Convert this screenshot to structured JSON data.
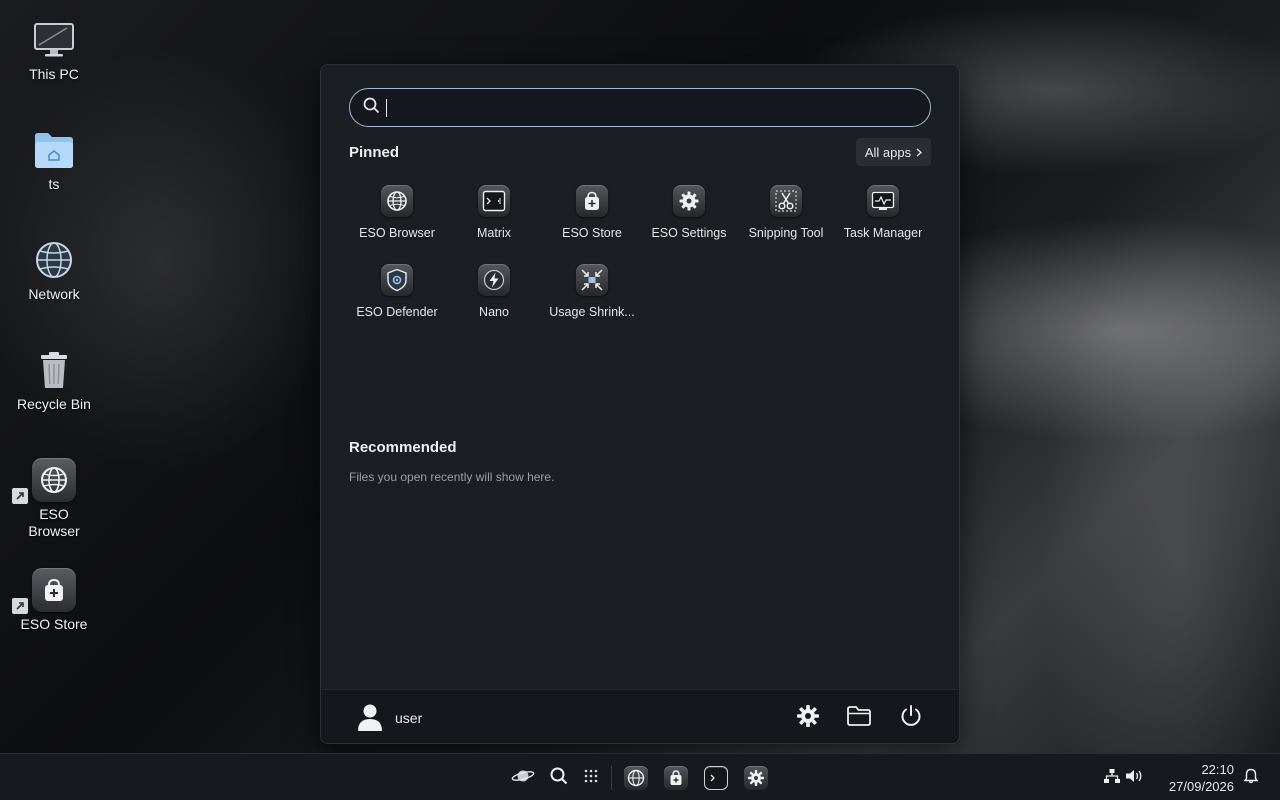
{
  "desktop": {
    "icons": [
      {
        "label": "This PC",
        "icon": "monitor-icon"
      },
      {
        "label": "ts",
        "icon": "home-folder-icon"
      },
      {
        "label": "Network",
        "icon": "globe-icon"
      },
      {
        "label": "Recycle Bin",
        "icon": "trash-icon"
      },
      {
        "label": "ESO\nBrowser",
        "icon": "browser-icon",
        "shortcut": true
      },
      {
        "label": "ESO Store",
        "icon": "store-icon",
        "shortcut": true
      }
    ]
  },
  "start_menu": {
    "search": {
      "value": "",
      "placeholder": ""
    },
    "pinned_title": "Pinned",
    "all_apps_label": "All apps",
    "pinned": [
      {
        "label": "ESO Browser",
        "icon": "globe-icon"
      },
      {
        "label": "Matrix",
        "icon": "terminal-icon"
      },
      {
        "label": "ESO Store",
        "icon": "store-icon"
      },
      {
        "label": "ESO Settings",
        "icon": "gear-icon"
      },
      {
        "label": "Snipping Tool",
        "icon": "scissors-icon"
      },
      {
        "label": "Task Manager",
        "icon": "activity-icon"
      },
      {
        "label": "ESO Defender",
        "icon": "shield-icon"
      },
      {
        "label": "Nano",
        "icon": "lightning-icon"
      },
      {
        "label": "Usage Shrink...",
        "icon": "compress-icon"
      }
    ],
    "recommended_title": "Recommended",
    "recommended_empty": "Files you open recently will show here.",
    "footer": {
      "user_name": "user",
      "buttons": [
        "gear-icon",
        "folder-icon",
        "power-icon"
      ]
    }
  },
  "taskbar": {
    "left_items": [
      "planet-icon",
      "search-icon",
      "app-grid-icon"
    ],
    "apps": [
      "browser-icon",
      "store-icon",
      "terminal-icon",
      "settings-icon"
    ],
    "tray": [
      "network-icon",
      "volume-icon"
    ],
    "time": "22:10",
    "date": "27/09/2026",
    "notification_icon": "bell-icon"
  },
  "colors": {
    "accent": "#9fb6d6",
    "menu_bg": "#1b1e23",
    "taskbar_bg": "#16191d"
  }
}
